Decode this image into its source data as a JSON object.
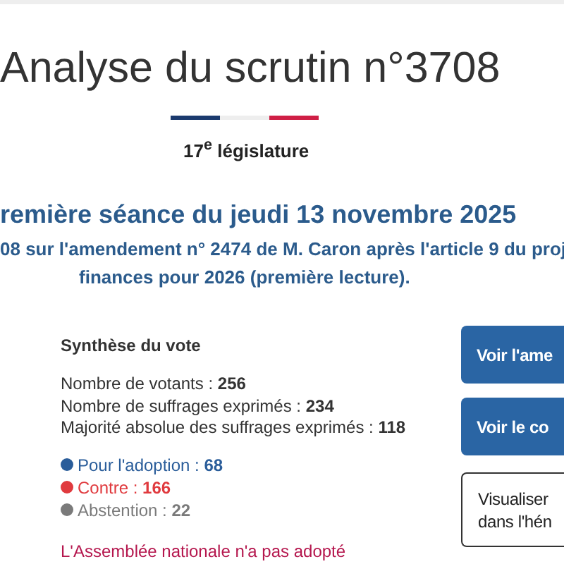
{
  "title": "Analyse du scrutin n°3708",
  "legislature": "17$^{e}$ législature",
  "session": "remière séance du jeudi 13 novembre 2025",
  "subject_lines": [
    "08 sur l'amendement n° 2474 de M. Caron après l'article 9 du proj",
    "finances pour 2026 (première lecture)."
  ],
  "summary": {
    "heading": "Synthèse du vote",
    "counts": [
      "Nombre de votants : **256**",
      "Nombre de suffrages exprimés : **234**",
      "Majorité absolue des suffrages exprimés : **118**"
    ],
    "votes": [
      {
        "label": "Pour l'adoption : ",
        "count": "68",
        "color": "#2a5d9a"
      },
      {
        "label": "Contre : ",
        "count": "166",
        "color": "#e03a3e"
      },
      {
        "label": "Abstention : ",
        "count": "22",
        "color": "#7a7a7a"
      }
    ],
    "result": "L'Assemblée nationale n'a pas adopté"
  },
  "buttons": [
    {
      "kind": "primary",
      "lines": [
        "Voir l'ame"
      ]
    },
    {
      "kind": "primary",
      "lines": [
        "Voir le co"
      ]
    },
    {
      "kind": "outline",
      "lines": [
        "Visualiser",
        "dans l'hén"
      ]
    }
  ]
}
